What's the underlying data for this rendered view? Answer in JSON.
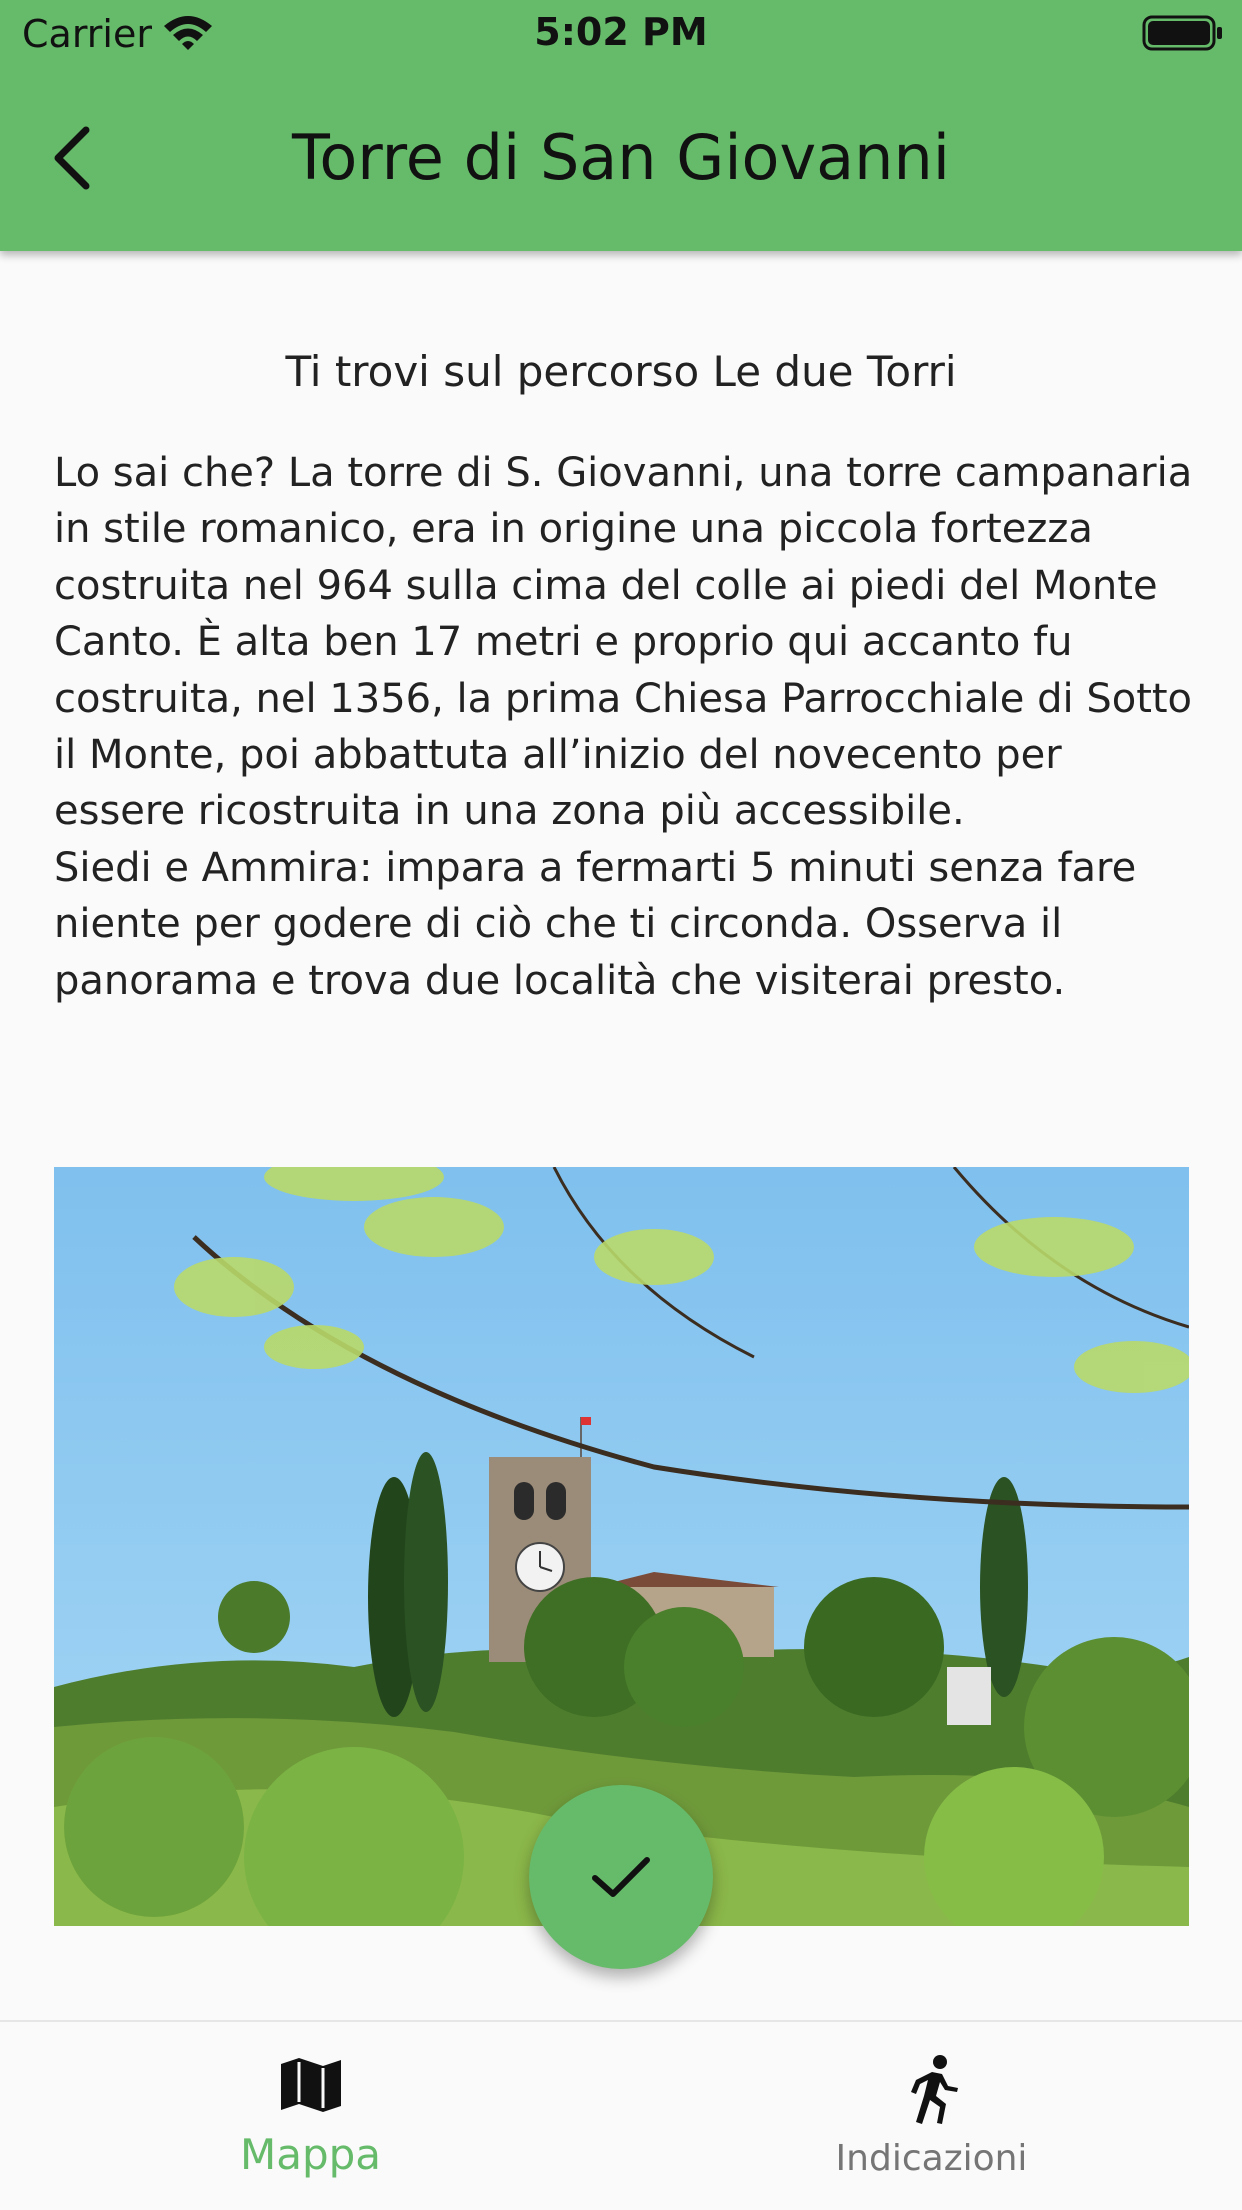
{
  "status_bar": {
    "carrier": "Carrier",
    "time": "5:02 PM"
  },
  "app_bar": {
    "title": "Torre di San Giovanni",
    "back_icon": "arrow-back-icon"
  },
  "content": {
    "route_text": "Ti trovi sul percorso Le due Torri",
    "paragraphs": [
      "Lo sai che? La torre di S. Giovanni, una torre campanaria in stile romanico, era in origine una piccola fortezza costruita nel 964 sulla cima del colle ai piedi del Monte Canto. È alta ben 17 metri e proprio qui accanto fu costruita, nel 1356, la prima Chiesa Parrocchiale di Sotto il Monte, poi abbattuta all’inizio del novecento per essere ricostruita in una zona più accessibile.",
      "Siedi e Ammira: impara a fermarti 5 minuti senza fare niente per godere di ciò che ti circonda. Osserva il panorama e trova due località che visiterai presto."
    ]
  },
  "fab": {
    "icon": "check-icon"
  },
  "bottom_nav": {
    "items": [
      {
        "label": "Mappa",
        "icon": "map-icon",
        "active": true
      },
      {
        "label": "Indicazioni",
        "icon": "directions-run-icon",
        "active": false
      }
    ]
  },
  "colors": {
    "accent": "#66bb6a",
    "inactive": "#757575"
  }
}
